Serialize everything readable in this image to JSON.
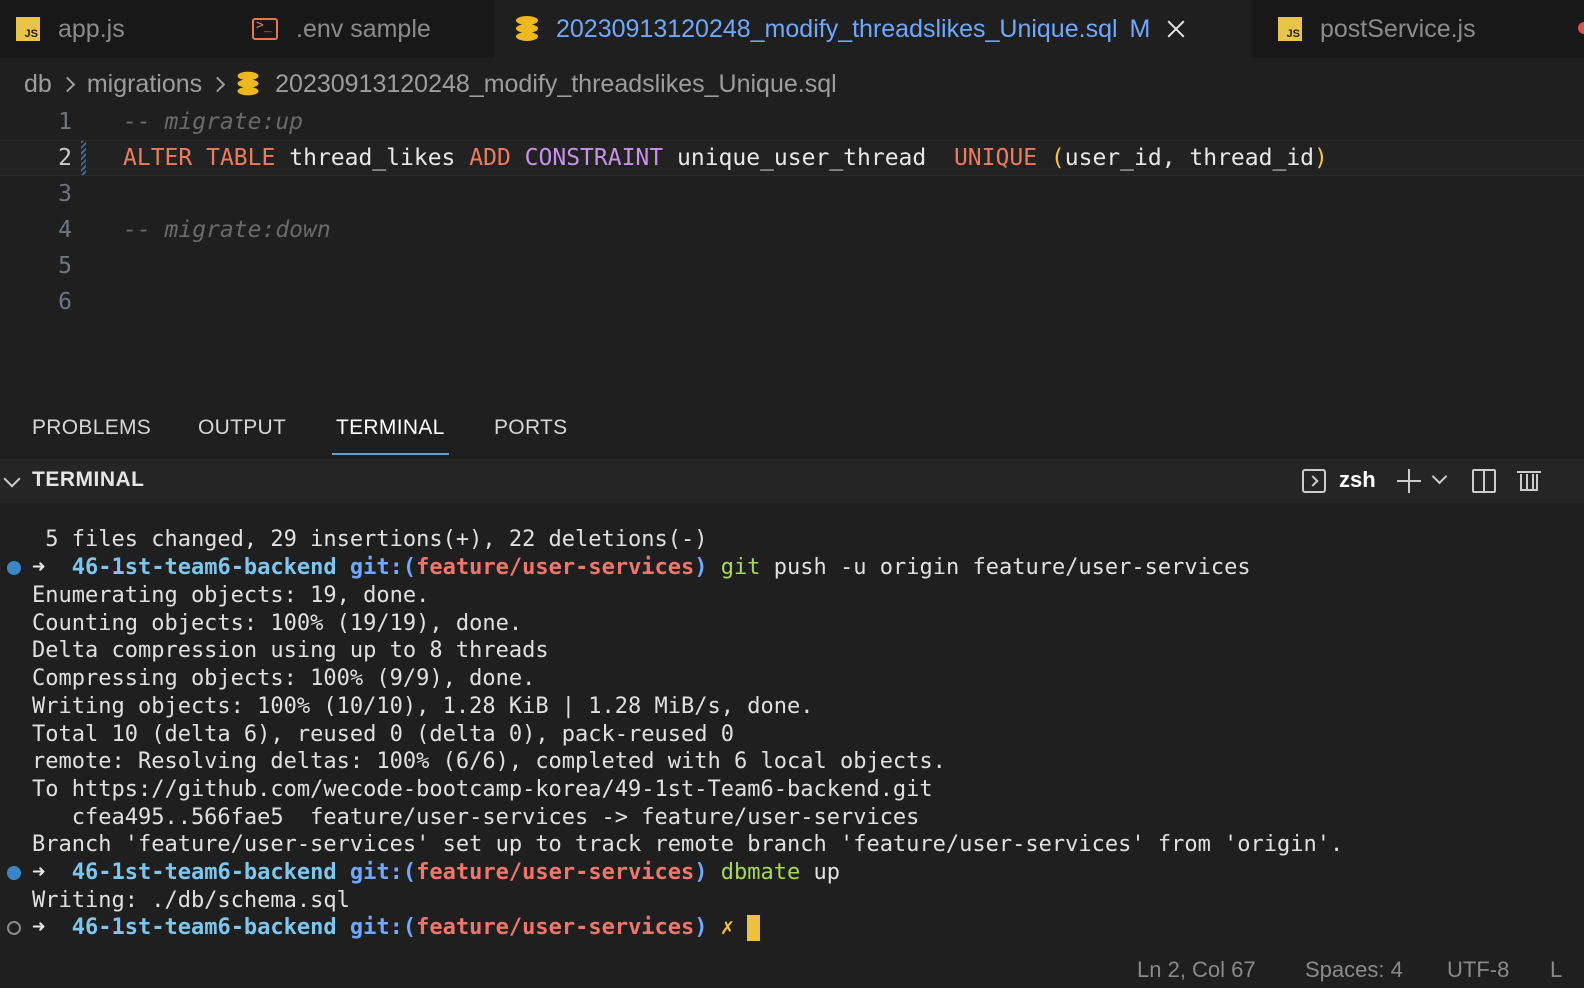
{
  "tabs": [
    {
      "label": "app.js",
      "icon": "js-file-icon"
    },
    {
      "label": ".env sample",
      "icon": "terminal-file-icon"
    },
    {
      "label": "20230913120248_modify_threadslikes_Unique.sql",
      "icon": "database-file-icon",
      "modified": "M",
      "active": true
    },
    {
      "label": "postService.js",
      "icon": "js-file-icon"
    }
  ],
  "breadcrumb": {
    "items": [
      "db",
      "migrations",
      "20230913120248_modify_threadslikes_Unique.sql"
    ]
  },
  "editor": {
    "line_numbers": [
      "1",
      "2",
      "3",
      "4",
      "5",
      "6"
    ],
    "current_line": 2,
    "lines": {
      "l1": "-- migrate:up",
      "l2_alter": "ALTER",
      "l2_table": "TABLE",
      "l2_name": "thread_likes",
      "l2_add": "ADD",
      "l2_constraint": "CONSTRAINT",
      "l2_cname": "unique_user_thread",
      "l2_unique": "UNIQUE",
      "l2_open": "(",
      "l2_cols": "user_id, thread_id",
      "l2_close": ")",
      "l4": "-- migrate:down"
    }
  },
  "panel_tabs": [
    {
      "label": "PROBLEMS"
    },
    {
      "label": "OUTPUT"
    },
    {
      "label": "TERMINAL",
      "active": true
    },
    {
      "label": "PORTS"
    }
  ],
  "terminal": {
    "title": "TERMINAL",
    "shell": "zsh",
    "prompt": {
      "arrow": "➜",
      "project": "46-1st-team6-backend",
      "git": "git:(",
      "branch": "feature/user-services",
      "git_close": ")",
      "dirty": "✗"
    },
    "output": {
      "o0": " 5 files changed, 29 insertions(+), 22 deletions(-)",
      "cmd1": "git",
      "cmd1_args": "push -u origin feature/user-services",
      "o1": "Enumerating objects: 19, done.",
      "o2": "Counting objects: 100% (19/19), done.",
      "o3": "Delta compression using up to 8 threads",
      "o4": "Compressing objects: 100% (9/9), done.",
      "o5": "Writing objects: 100% (10/10), 1.28 KiB | 1.28 MiB/s, done.",
      "o6": "Total 10 (delta 6), reused 0 (delta 0), pack-reused 0",
      "o7": "remote: Resolving deltas: 100% (6/6), completed with 6 local objects.",
      "o8": "To https://github.com/wecode-bootcamp-korea/49-1st-Team6-backend.git",
      "o9": "   cfea495..566fae5  feature/user-services -> feature/user-services",
      "o10": "Branch 'feature/user-services' set up to track remote branch 'feature/user-services' from 'origin'.",
      "cmd2": "dbmate",
      "cmd2_args": "up",
      "o11": "Writing: ./db/schema.sql"
    }
  },
  "statusbar": {
    "position": "Ln 2, Col 67",
    "spaces": "Spaces: 4",
    "encoding": "UTF-8",
    "eol": "L"
  },
  "colors": {
    "accent": "#5fa0d6",
    "active_tab_text": "#6fa8ff",
    "sql_keyword": "#f07a5c",
    "sql_constraint": "#c792ea",
    "paren": "#f5c242",
    "prompt_project": "#7cc6f0",
    "prompt_branch": "#f0766b",
    "command": "#a6d955"
  }
}
